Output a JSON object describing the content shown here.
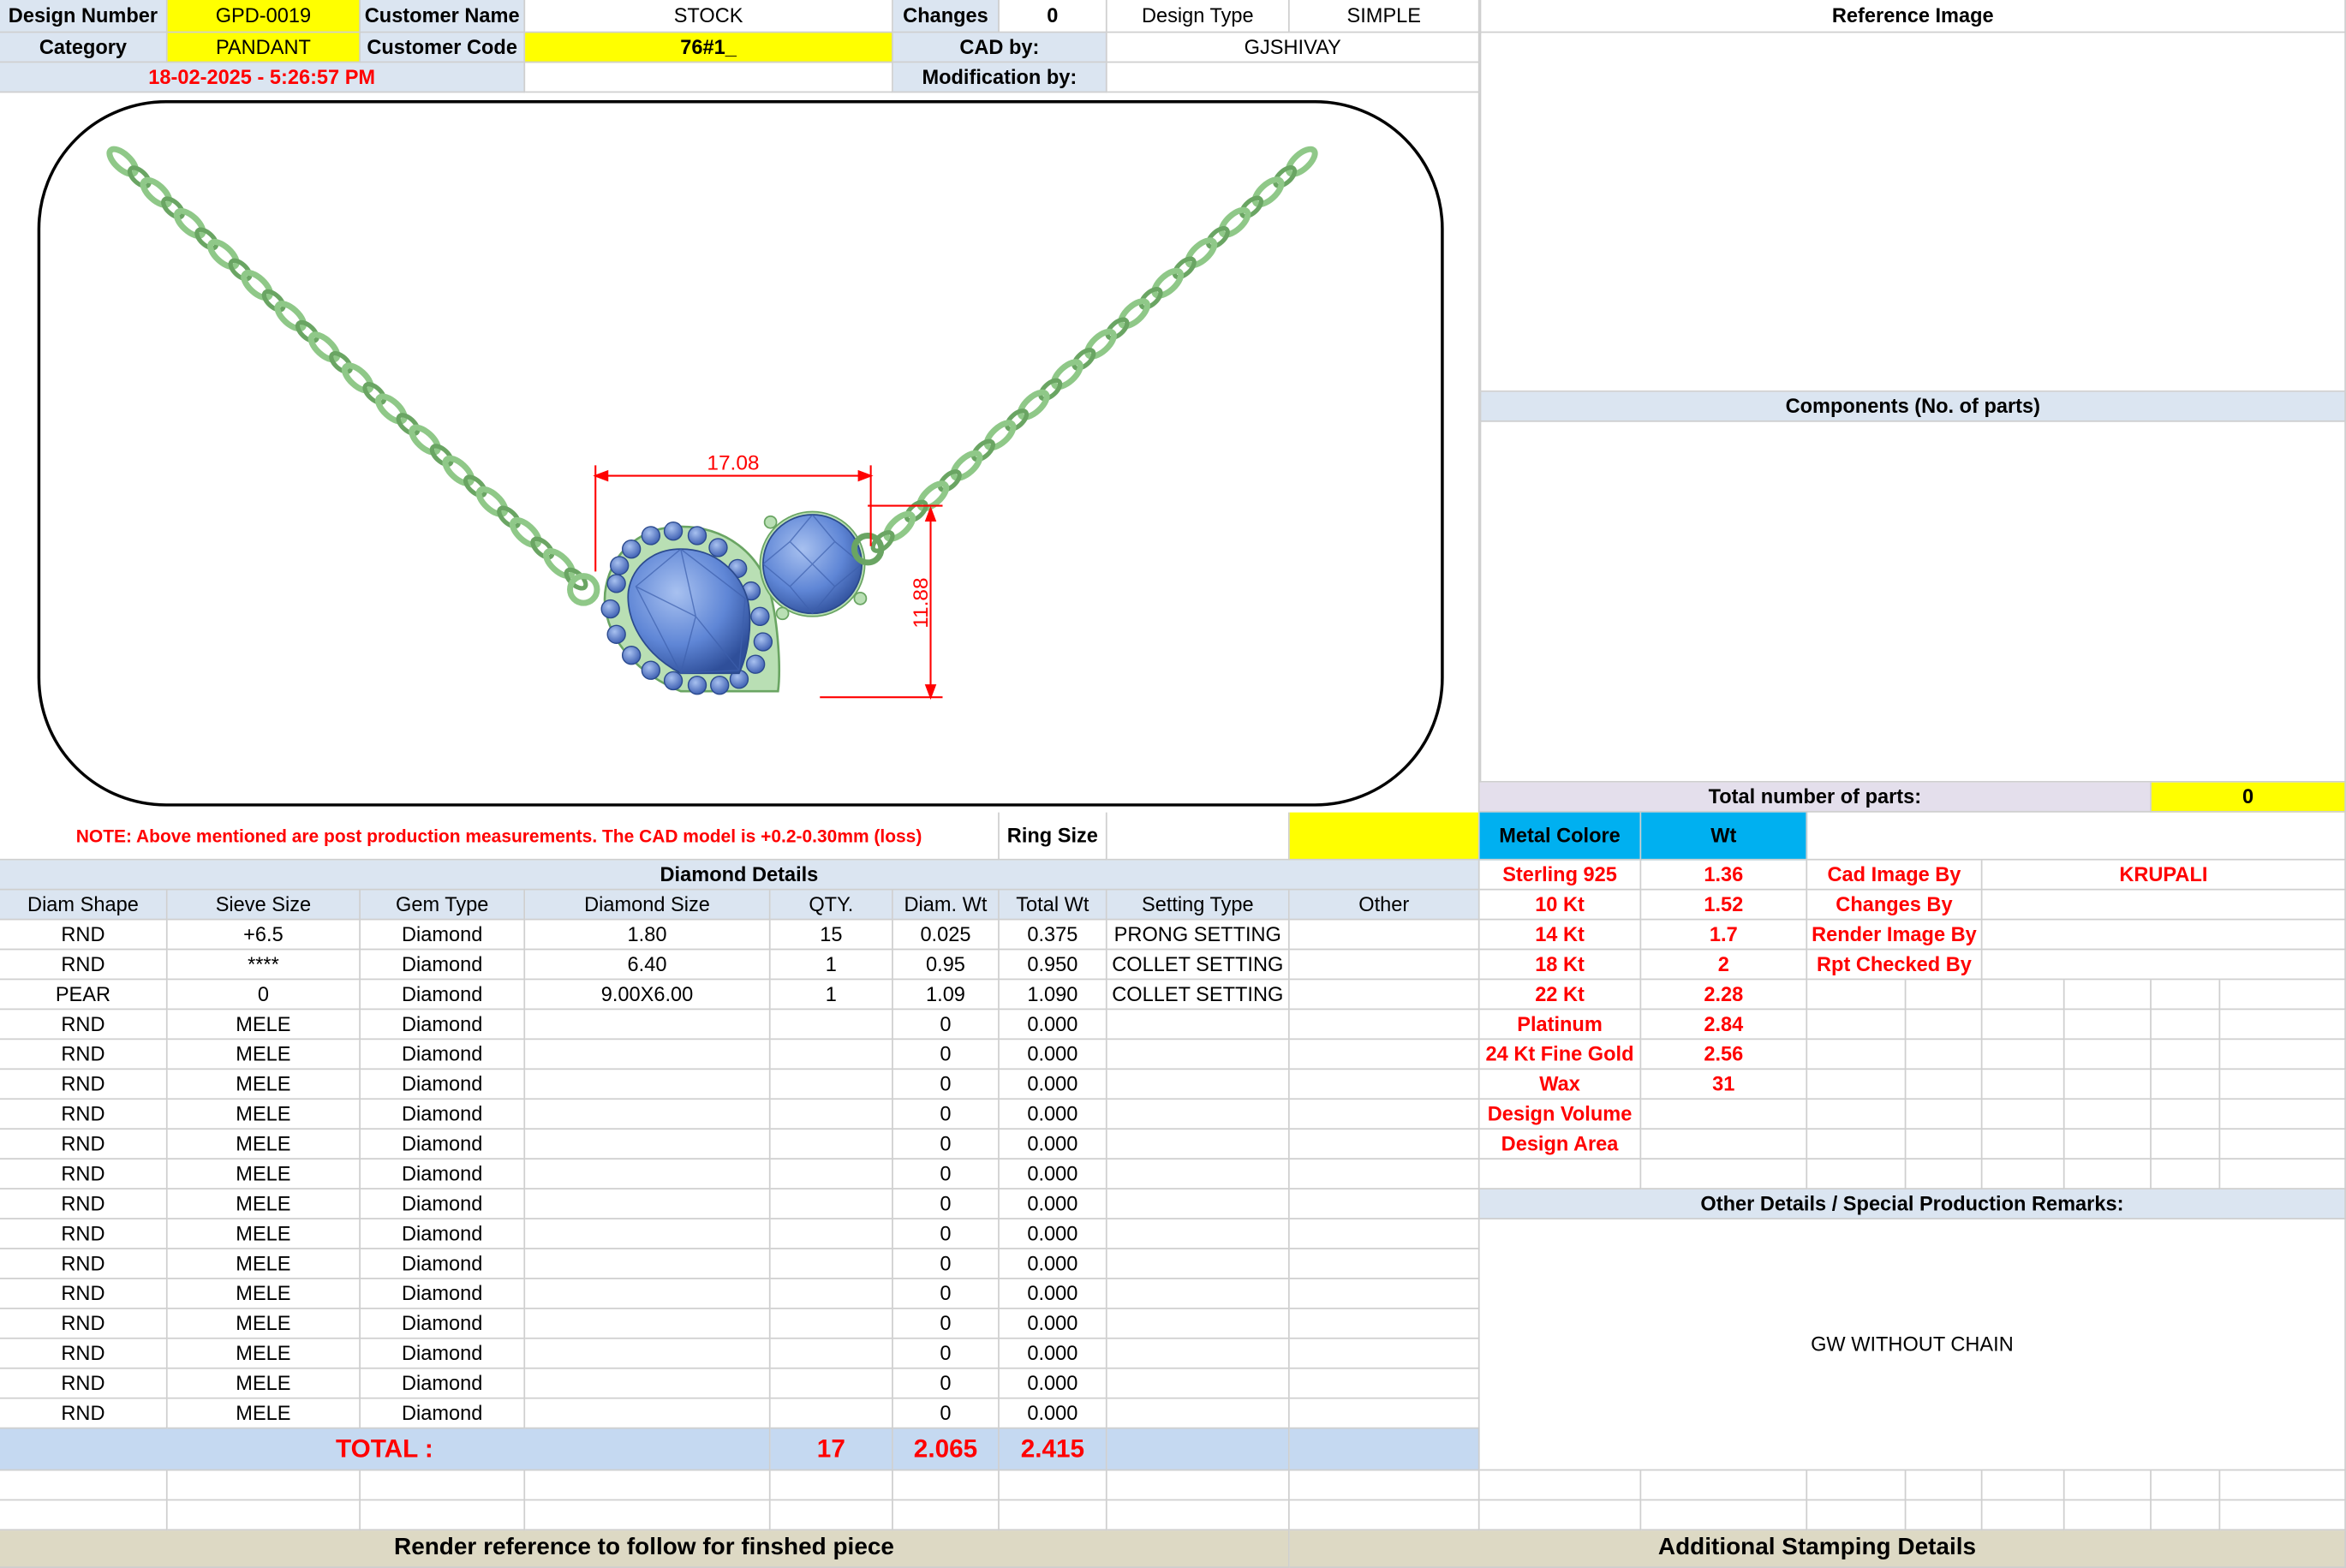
{
  "header": {
    "design_number_label": "Design Number",
    "design_number": "GPD-0019",
    "customer_name_label": "Customer Name",
    "customer_name": "STOCK",
    "changes_label": "Changes",
    "changes": "0",
    "design_type_label": "Design Type",
    "design_type": "SIMPLE",
    "category_label": "Category",
    "category": "PANDANT",
    "customer_code_label": "Customer Code",
    "customer_code": "76#1_",
    "cad_by_label": "CAD by:",
    "cad_by": "GJSHIVAY",
    "timestamp": "18-02-2025 - 5:26:57 PM",
    "modification_by_label": "Modification by:",
    "modification_by": ""
  },
  "right_panel": {
    "reference_image_label": "Reference Image",
    "components_label": "Components (No. of parts)",
    "total_parts_label": "Total number of parts:",
    "total_parts": "0"
  },
  "drawing": {
    "dim_width": "17.08",
    "dim_height": "11.88"
  },
  "note": "NOTE: Above mentioned are post production measurements. The CAD model is +0.2-0.30mm (loss)",
  "ring_size_label": "Ring Size",
  "diamond": {
    "title": "Diamond Details",
    "headers": [
      "Diam Shape",
      "Sieve Size",
      "Gem Type",
      "Diamond Size",
      "QTY.",
      "Diam. Wt",
      "Total Wt",
      "Setting Type",
      "Other"
    ],
    "rows": [
      [
        "RND",
        "+6.5",
        "Diamond",
        "1.80",
        "15",
        "0.025",
        "0.375",
        "PRONG SETTING",
        ""
      ],
      [
        "RND",
        "****",
        "Diamond",
        "6.40",
        "1",
        "0.95",
        "0.950",
        "COLLET SETTING",
        ""
      ],
      [
        "PEAR",
        "0",
        "Diamond",
        "9.00X6.00",
        "1",
        "1.09",
        "1.090",
        "COLLET SETTING",
        ""
      ],
      [
        "RND",
        "MELE",
        "Diamond",
        "",
        "",
        "0",
        "0.000",
        "",
        ""
      ],
      [
        "RND",
        "MELE",
        "Diamond",
        "",
        "",
        "0",
        "0.000",
        "",
        ""
      ],
      [
        "RND",
        "MELE",
        "Diamond",
        "",
        "",
        "0",
        "0.000",
        "",
        ""
      ],
      [
        "RND",
        "MELE",
        "Diamond",
        "",
        "",
        "0",
        "0.000",
        "",
        ""
      ],
      [
        "RND",
        "MELE",
        "Diamond",
        "",
        "",
        "0",
        "0.000",
        "",
        ""
      ],
      [
        "RND",
        "MELE",
        "Diamond",
        "",
        "",
        "0",
        "0.000",
        "",
        ""
      ],
      [
        "RND",
        "MELE",
        "Diamond",
        "",
        "",
        "0",
        "0.000",
        "",
        ""
      ],
      [
        "RND",
        "MELE",
        "Diamond",
        "",
        "",
        "0",
        "0.000",
        "",
        ""
      ],
      [
        "RND",
        "MELE",
        "Diamond",
        "",
        "",
        "0",
        "0.000",
        "",
        ""
      ],
      [
        "RND",
        "MELE",
        "Diamond",
        "",
        "",
        "0",
        "0.000",
        "",
        ""
      ],
      [
        "RND",
        "MELE",
        "Diamond",
        "",
        "",
        "0",
        "0.000",
        "",
        ""
      ],
      [
        "RND",
        "MELE",
        "Diamond",
        "",
        "",
        "0",
        "0.000",
        "",
        ""
      ],
      [
        "RND",
        "MELE",
        "Diamond",
        "",
        "",
        "0",
        "0.000",
        "",
        ""
      ],
      [
        "RND",
        "MELE",
        "Diamond",
        "",
        "",
        "0",
        "0.000",
        "",
        ""
      ]
    ],
    "total_label": "TOTAL :",
    "total_qty": "17",
    "total_diam_wt": "2.065",
    "total_wt": "2.415"
  },
  "metal": {
    "color_label": "Metal Colore",
    "wt_label": "Wt",
    "rows": [
      [
        "Sterling 925",
        "1.36"
      ],
      [
        "10 Kt",
        "1.52"
      ],
      [
        "14 Kt",
        "1.7"
      ],
      [
        "18 Kt",
        "2"
      ],
      [
        "22 Kt",
        "2.28"
      ],
      [
        "Platinum",
        "2.84"
      ],
      [
        "24 Kt Fine Gold",
        "2.56"
      ],
      [
        "Wax",
        "31"
      ],
      [
        "Design Volume",
        ""
      ],
      [
        "Design Area",
        ""
      ]
    ]
  },
  "credits": [
    [
      "Cad Image By",
      "KRUPALI"
    ],
    [
      "Changes By",
      ""
    ],
    [
      "Render Image By",
      ""
    ],
    [
      "Rpt Checked By",
      ""
    ]
  ],
  "other_details_label": "Other Details / Special Production Remarks:",
  "other_details_text": "GW WITHOUT CHAIN",
  "render_reference_label": "Render reference to follow for finshed piece",
  "stamping_label": "Additional Stamping Details",
  "colors": {
    "yellow": "#ffff00",
    "header_blue": "#dbe5f1",
    "total_blue": "#c5d9f1",
    "cyan": "#00b0f0",
    "red": "#ff0000",
    "beige": "#ddd9c4",
    "metal_green": "#a9d6a3",
    "gem_blue": "#6f94dc"
  }
}
